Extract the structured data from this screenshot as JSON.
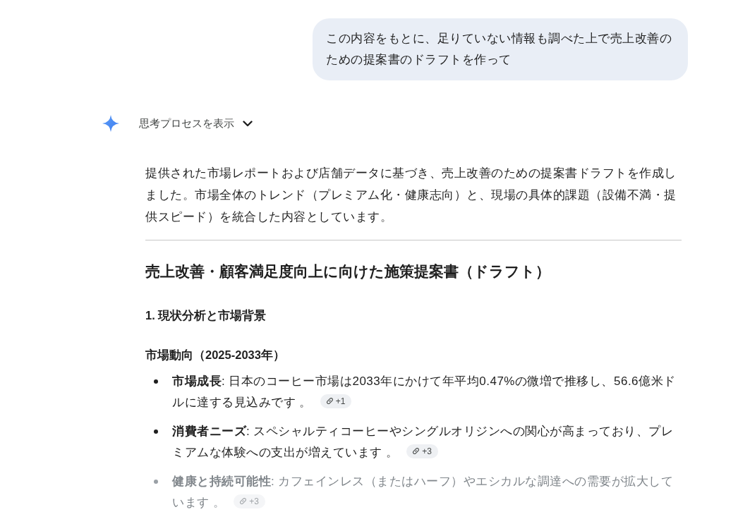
{
  "user_message": {
    "text": "この内容をもとに、足りていない情報も調べた上で売上改善のための提案書のドラフトを作って"
  },
  "response": {
    "thinking_toggle": {
      "label": "思考プロセスを表示",
      "expanded": false
    },
    "intro": "提供された市場レポートおよび店舗データに基づき、売上改善のための提案書ドラフトを作成しました。市場全体のトレンド（プレミアム化・健康志向）と、現場の具体的課題（設備不満・提供スピード）を統合した内容としています。",
    "title": "売上改善・顧客満足度向上に向けた施策提案書（ドラフト）",
    "sections": [
      {
        "heading": "1. 現状分析と市場背景",
        "subsections": [
          {
            "heading": "市場動向（2025-2033年）",
            "bullets": [
              {
                "text": "**市場成長**: 日本のコーヒー市場は2033年にかけて年平均0.47%の微増で推移し、56.6億米ドルに達する見込みです 。",
                "sources": "+1",
                "faded": false
              },
              {
                "text": "**消費者ニーズ**: スペシャルティコーヒーやシングルオリジンへの関心が高まっており、プレミアムな体験への支出が増えています 。",
                "sources": "+3",
                "faded": false
              },
              {
                "text": "**健康と持続可能性**: カフェインレス（またはハーフ）やエシカルな調達への需要が拡大しています 。",
                "sources": "+3",
                "faded": true
              }
            ]
          }
        ]
      }
    ]
  }
}
